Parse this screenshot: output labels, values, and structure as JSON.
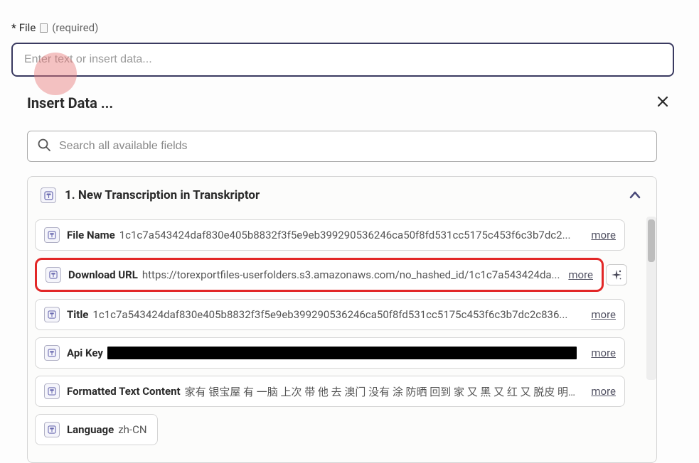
{
  "field": {
    "asterisk": "*",
    "label": "File",
    "required": "(required)",
    "placeholder": "Enter text or insert data..."
  },
  "panel": {
    "title": "Insert Data ...",
    "search_placeholder": "Search all available fields"
  },
  "source": {
    "title": "1. New Transcription in Transkriptor"
  },
  "fields": [
    {
      "name": "File Name",
      "value": "1c1c7a543424daf830e405b8832f3f5e9eb399290536246ca50f8fd531cc5175c453f6c3b7dc2...",
      "more": "more"
    },
    {
      "name": "Download URL",
      "value": "https://torexportfiles-userfolders.s3.amazonaws.com/no_hashed_id/1c1c7a543424da...",
      "more": "more"
    },
    {
      "name": "Title",
      "value": "1c1c7a543424daf830e405b8832f3f5e9eb399290536246ca50f8fd531cc5175c453f6c3b7dc2c836...",
      "more": "more"
    },
    {
      "name": "Api Key",
      "value": "",
      "more": "more",
      "redacted": true
    },
    {
      "name": "Formatted Text Content",
      "value": "家有 银宝屋 有 一脑 上次 带 他 去 澳门 没有 涂 防晒 回到 家 又 黑 又 红 又 脱皮 明明 太...",
      "more": "more"
    },
    {
      "name": "Language",
      "value": "zh-CN"
    }
  ]
}
